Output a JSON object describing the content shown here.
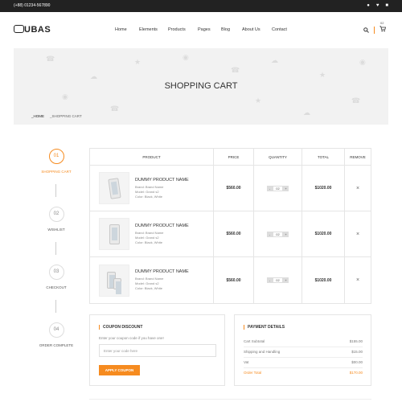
{
  "topbar": {
    "phone": "(+88) 01234-567890"
  },
  "header": {
    "logo": "UBAS",
    "nav": [
      "Home",
      "Elements",
      "Products",
      "Pages",
      "Blog",
      "About Us",
      "Contact"
    ],
    "cart_count": "02"
  },
  "banner": {
    "title": "SHOPPING CART",
    "crumb_home": "_HOME",
    "crumb_current": "_SHOPPING CART"
  },
  "steps": [
    {
      "num": "01",
      "label": "SHOPPING CART"
    },
    {
      "num": "02",
      "label": "WISHLIST"
    },
    {
      "num": "03",
      "label": "CHECKOUT"
    },
    {
      "num": "04",
      "label": "ORDER COMPLETE"
    }
  ],
  "table": {
    "headers": [
      "PRODUCT",
      "PRICE",
      "QUANTITY",
      "TOTAL",
      "REMOVE"
    ],
    "rows": [
      {
        "name": "DUMMY PRODUCT NAME",
        "brand": "Brand: Brand Name",
        "model": "Model: Grand s2",
        "color": "Color: Black, White",
        "price": "$560.00",
        "qty": "02",
        "total": "$1020.00",
        "remove": "×"
      },
      {
        "name": "DUMMY PRODUCT NAME",
        "brand": "Brand: Brand Name",
        "model": "Model: Grand s2",
        "color": "Color: Black, White",
        "price": "$560.00",
        "qty": "02",
        "total": "$1020.00",
        "remove": "×"
      },
      {
        "name": "DUMMY PRODUCT NAME",
        "brand": "Brand: Brand Name",
        "model": "Model: Grand s2",
        "color": "Color: Black, White",
        "price": "$560.00",
        "qty": "02",
        "total": "$1020.00",
        "remove": "×"
      }
    ]
  },
  "coupon": {
    "title": "COUPON DISCOUNT",
    "text": "Enter your coupon code if you have one!",
    "placeholder": "Enter your code here",
    "button": "APPLY COUPON"
  },
  "payment": {
    "title": "PAYMENT DETAILS",
    "rows": [
      {
        "label": "Cart Subtotal",
        "value": "$155.00"
      },
      {
        "label": "Shipping and Handling",
        "value": "$15.00"
      },
      {
        "label": "Vat",
        "value": "$00.00"
      },
      {
        "label": "Order Total",
        "value": "$170.00"
      }
    ]
  },
  "colors": {
    "accent": "#f68b1f",
    "topbar": "#222222",
    "banner": "#f2f2f2"
  },
  "icons": [
    "user-icon",
    "heart-icon",
    "bag-icon",
    "search-icon",
    "cart-icon",
    "close-icon"
  ]
}
